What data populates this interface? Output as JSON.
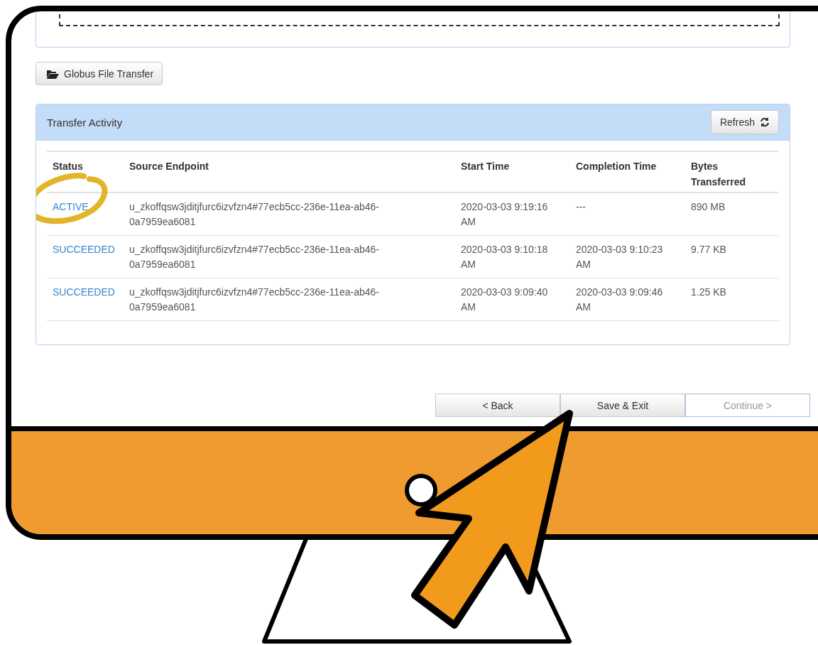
{
  "globus_button": {
    "label": "Globus File Transfer"
  },
  "transfer_activity": {
    "title": "Transfer Activity",
    "refresh_button": {
      "label": "Refresh"
    },
    "columns": [
      "Status",
      "Source Endpoint",
      "Start Time",
      "Completion Time",
      "Bytes Transferred"
    ],
    "rows": [
      {
        "status": "ACTIVE",
        "circled": true,
        "source": "u_zkoffqsw3jditjfurc6izvfzn4#77ecb5cc-236e-11ea-ab46-0a7959ea6081",
        "start": "2020-03-03 9:19:16 AM",
        "completion": "---",
        "bytes": "890 MB"
      },
      {
        "status": "SUCCEEDED",
        "circled": false,
        "source": "u_zkoffqsw3jditjfurc6izvfzn4#77ecb5cc-236e-11ea-ab46-0a7959ea6081",
        "start": "2020-03-03 9:10:18 AM",
        "completion": "2020-03-03 9:10:23 AM",
        "bytes": "9.77 KB"
      },
      {
        "status": "SUCCEEDED",
        "circled": false,
        "source": "u_zkoffqsw3jditjfurc6izvfzn4#77ecb5cc-236e-11ea-ab46-0a7959ea6081",
        "start": "2020-03-03 9:09:40 AM",
        "completion": "2020-03-03 9:09:46 AM",
        "bytes": "1.25 KB"
      }
    ]
  },
  "nav_buttons": [
    {
      "label": "< Back",
      "disabled": false
    },
    {
      "label": "Save & Exit",
      "disabled": false
    },
    {
      "label": "Continue >",
      "disabled": true
    }
  ]
}
